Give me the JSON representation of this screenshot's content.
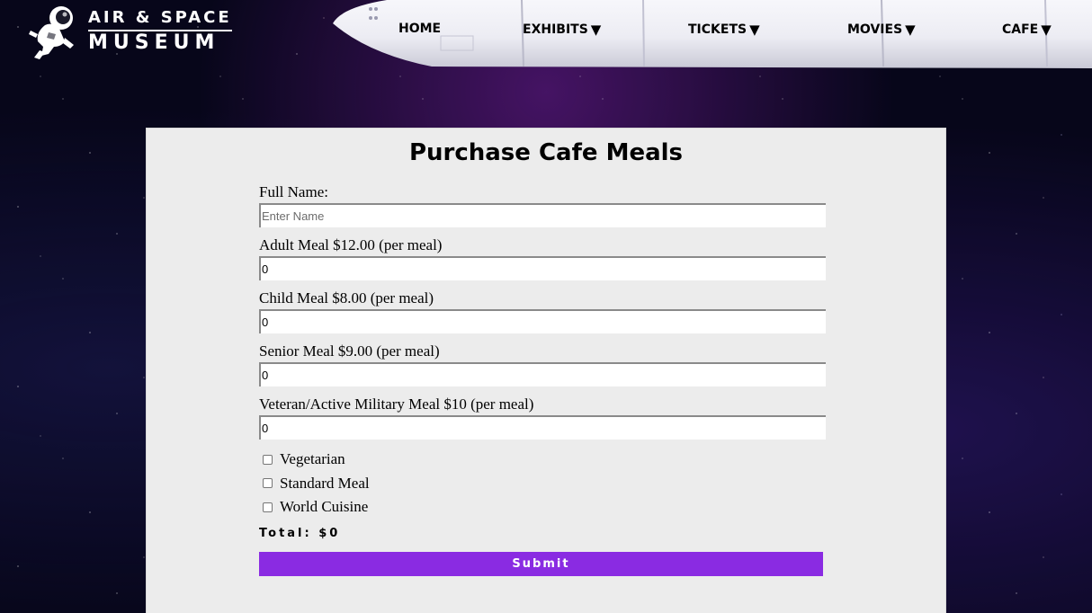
{
  "header": {
    "logo": {
      "line1": "AIR & SPACE",
      "line2": "MUSEUM"
    },
    "nav": [
      {
        "label": "HOME",
        "has_dropdown": false
      },
      {
        "label": "EXHIBITS",
        "has_dropdown": true
      },
      {
        "label": "TICKETS",
        "has_dropdown": true
      },
      {
        "label": "MOVIES",
        "has_dropdown": true
      },
      {
        "label": "CAFE",
        "has_dropdown": true
      }
    ],
    "caret": "▼"
  },
  "form": {
    "title": "Purchase Cafe Meals",
    "fields": [
      {
        "label": "Full Name:",
        "value": "",
        "placeholder": "Enter Name"
      },
      {
        "label": "Adult Meal $12.00 (per meal)",
        "value": "0",
        "placeholder": ""
      },
      {
        "label": "Child Meal $8.00 (per meal)",
        "value": "0",
        "placeholder": ""
      },
      {
        "label": "Senior Meal $9.00 (per meal)",
        "value": "0",
        "placeholder": ""
      },
      {
        "label": "Veteran/Active Military Meal $10 (per meal)",
        "value": "0",
        "placeholder": ""
      }
    ],
    "options": [
      {
        "label": "Vegetarian",
        "checked": false
      },
      {
        "label": "Standard Meal",
        "checked": false
      },
      {
        "label": "World Cuisine",
        "checked": false
      }
    ],
    "total_label": "Total: $0",
    "submit_label": "Submit"
  },
  "colors": {
    "accent": "#8a2be2",
    "panel_background": "#ececec",
    "page_background": "#07061a"
  }
}
